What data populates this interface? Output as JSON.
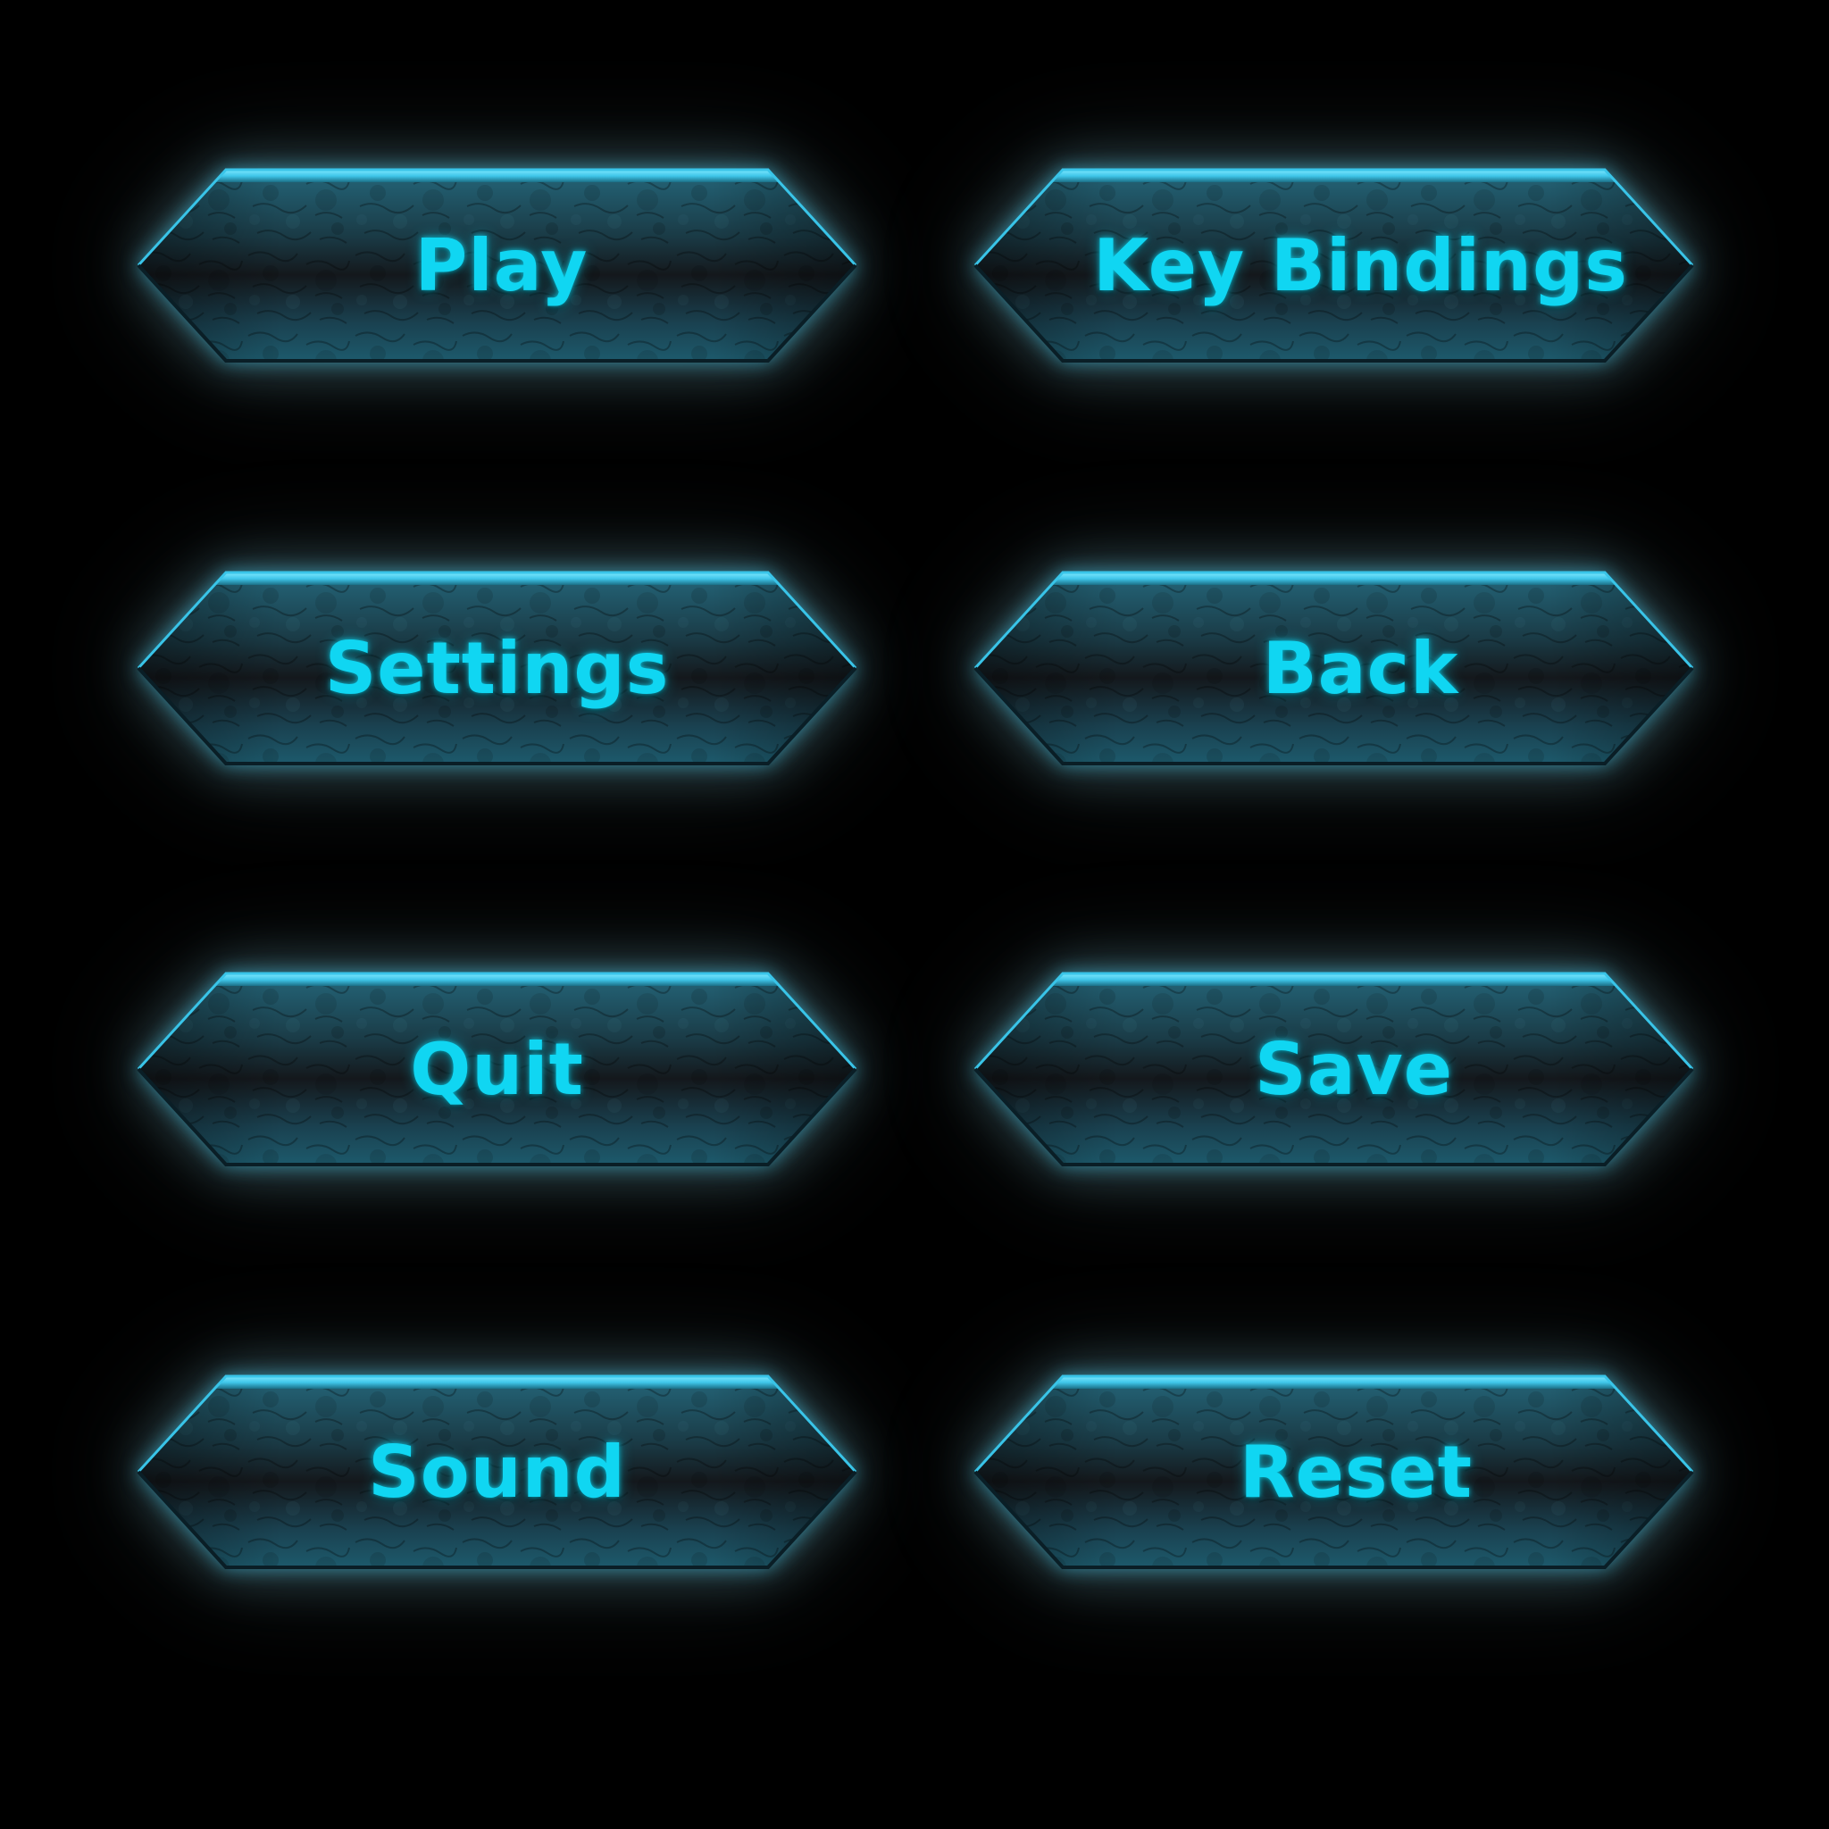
{
  "menu": {
    "buttons": [
      {
        "label": "Play"
      },
      {
        "label": "Key Bindings"
      },
      {
        "label": "Settings"
      },
      {
        "label": "Back"
      },
      {
        "label": "Quit"
      },
      {
        "label": "Save"
      },
      {
        "label": "Sound"
      },
      {
        "label": "Reset"
      }
    ]
  },
  "theme": {
    "background": "#000000",
    "label_color": "#10d6f2",
    "glow_color": "#46c8eb",
    "stone_dark": "#14181c",
    "stone_mid": "#1d4c5c",
    "bevel_light": "#3fd3f5"
  }
}
